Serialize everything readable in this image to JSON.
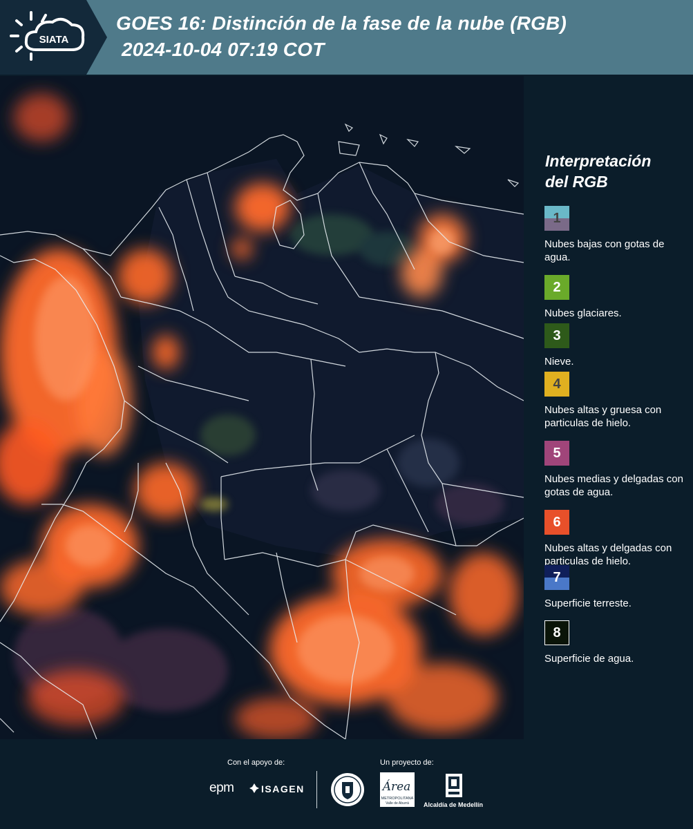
{
  "header": {
    "logo_text": "SIATA",
    "title_line1": "GOES 16: Distinción de la fase de la nube (RGB)",
    "title_line2": "2024-10-04 07:19 COT"
  },
  "legend": {
    "title_line1": "Interpretación",
    "title_line2": "del RGB",
    "items": [
      {
        "number": "1",
        "label": "Nubes bajas con gotas de agua.",
        "color_top": "#6ab8c8",
        "color_bottom": "#7a6a88",
        "number_color": "#444444"
      },
      {
        "number": "2",
        "label": "Nubes glaciares.",
        "color_top": "#6aaa2a",
        "color_bottom": "#6aaa2a",
        "number_color": "#ffffff"
      },
      {
        "number": "3",
        "label": "Nieve.",
        "color_top": "#2e5a1a",
        "color_bottom": "#2e5a1a",
        "number_color": "#ffffff"
      },
      {
        "number": "4",
        "label": "Nubes altas y gruesa con particulas de hielo.",
        "color_top": "#e0b020",
        "color_bottom": "#e0b020",
        "number_color": "#444444"
      },
      {
        "number": "5",
        "label": "Nubes medias y delgadas con gotas de agua.",
        "color_top": "#a0457a",
        "color_bottom": "#a0457a",
        "number_color": "#ffffff"
      },
      {
        "number": "6",
        "label": "Nubes altas y delgadas con particulas de hielo.",
        "color_top": "#e8502a",
        "color_bottom": "#e8502a",
        "number_color": "#ffffff"
      },
      {
        "number": "7",
        "label": "Superficie terreste.",
        "color_top": "#0f1f5a",
        "color_bottom": "#4a78c8",
        "number_color": "#ffffff"
      },
      {
        "number": "8",
        "label": "Superficie de agua.",
        "color_top": "#0a1408",
        "color_bottom": "#0a1408",
        "number_color": "#ffffff"
      }
    ]
  },
  "footer": {
    "support_label": "Con el apoyo de:",
    "project_label": "Un proyecto de:",
    "sponsor_1": "epm",
    "sponsor_2": "ISAGEN",
    "area_text": "Área",
    "area_sub": "METROPOLITANA",
    "area_sub2": "Valle de Aburrá",
    "alcaldia": "Alcaldía de Medellín"
  },
  "colors": {
    "header_bg": "#4f7a8a",
    "logo_bg": "#13293a",
    "page_bg": "#0b1d2a",
    "cloud_orange": "#ff6a2a",
    "border_lines": "#e8eef2"
  },
  "icons": {
    "logo": "siata-sun-cloud-logo",
    "area_logo": "area-metropolitana-logo",
    "alcaldia_logo": "alcaldia-shield-icon",
    "medellin_seal": "medellin-seal-icon",
    "isagen_mark": "isagen-mark-icon"
  }
}
